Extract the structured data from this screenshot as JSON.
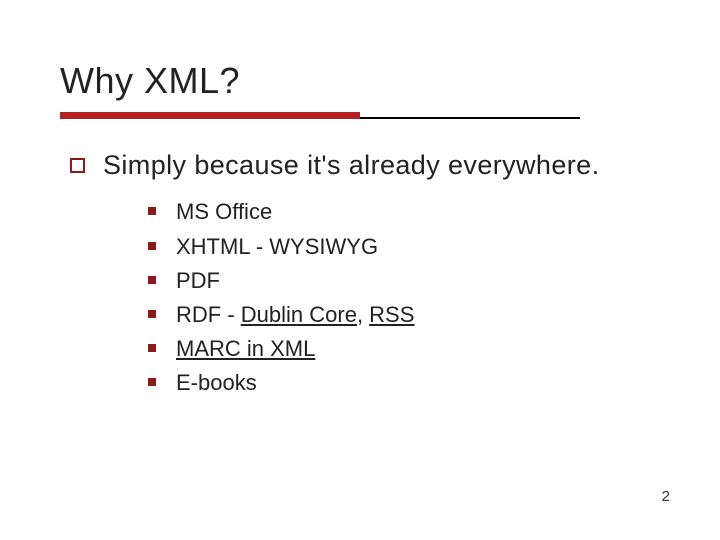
{
  "title": "Why XML?",
  "main": "Simply because it's already everywhere.",
  "sub": {
    "0": {
      "parts": [
        {
          "t": "MS Office",
          "link": false
        }
      ]
    },
    "1": {
      "parts": [
        {
          "t": "XHTML - WYSIWYG",
          "link": false
        }
      ]
    },
    "2": {
      "parts": [
        {
          "t": "PDF",
          "link": false
        }
      ]
    },
    "3": {
      "parts": [
        {
          "t": "RDF - ",
          "link": false
        },
        {
          "t": "Dublin Core",
          "link": true
        },
        {
          "t": ", ",
          "link": false
        },
        {
          "t": "RSS",
          "link": true
        }
      ]
    },
    "4": {
      "parts": [
        {
          "t": "MARC in XML",
          "link": true
        }
      ]
    },
    "5": {
      "parts": [
        {
          "t": "E-books",
          "link": false
        }
      ]
    }
  },
  "page": "2"
}
